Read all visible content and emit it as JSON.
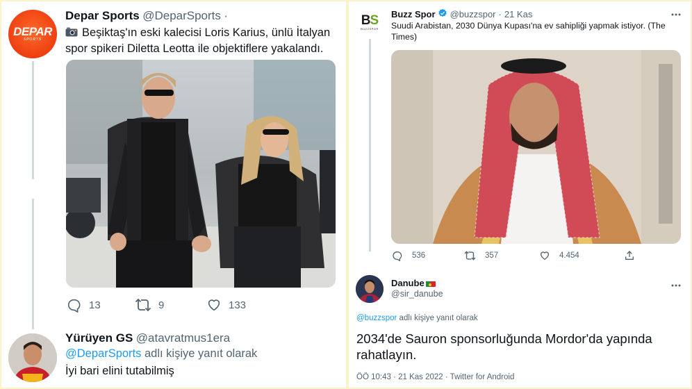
{
  "left_tweet": {
    "author_name": "Depar Sports",
    "author_handle": "@DeparSports",
    "dot": "·",
    "avatar_logo_main": "DEPAR",
    "avatar_logo_sub": "SPORTS",
    "text": "Beşiktaş'ın eski kalecisi Loris Karius, ünlü İtalyan spor spikeri Diletta Leotta ile objektiflere yakalandı.",
    "emoji_icon": "camera-icon",
    "actions": [
      {
        "icon": "reply-icon",
        "count": "13"
      },
      {
        "icon": "retweet-icon",
        "count": "9"
      },
      {
        "icon": "like-icon",
        "count": "133"
      }
    ]
  },
  "left_reply": {
    "author_name": "Yürüyen GS",
    "author_handle": "@atavratmus1era",
    "reply_prefix_mention": "@DeparSports",
    "reply_suffix": "adlı kişiye yanıt olarak",
    "text": "İyi bari elini tutabilmiş"
  },
  "right_tweet": {
    "author_name": "Buzz Spor",
    "author_handle": "@buzzspor",
    "dot": "·",
    "date": "21 Kas",
    "avatar_logo_letters_1": "B",
    "avatar_logo_letters_2": "S",
    "avatar_logo_sub": "BUZZSPOR",
    "text": "Suudi Arabistan, 2030 Dünya Kupası'na ev sahipliği yapmak istiyor. (The Times)",
    "more": "···",
    "actions": [
      {
        "icon": "reply-icon",
        "count": "536"
      },
      {
        "icon": "retweet-icon",
        "count": "357"
      },
      {
        "icon": "like-icon",
        "count": "4.454"
      },
      {
        "icon": "share-icon",
        "count": ""
      }
    ]
  },
  "right_reply": {
    "author_name": "Danube",
    "author_handle": "@sir_danube",
    "more": "···",
    "reply_prefix_mention": "@buzzspor",
    "reply_suffix": "adlı kişiye yanıt olarak",
    "text": "2034'de Sauron sponsorluğunda  Mordor'da yapında rahatlayın.",
    "meta": "ÖÖ 10:43 · 21 Kas 2022 · Twitter for Android"
  },
  "colors": {
    "background": "#fbf3c9",
    "link": "#1d9bf0",
    "muted": "#536471",
    "depar_orange": "#ee3f10",
    "verified": "#1d9bf0"
  }
}
